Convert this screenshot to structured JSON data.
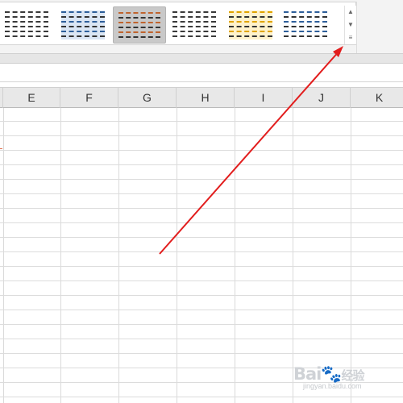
{
  "table_styles": {
    "styles": [
      {
        "name": "style-1",
        "line_color": "#3a3a3a",
        "band_color": "#ffffff"
      },
      {
        "name": "style-2",
        "line_color": "#2e5f9a",
        "band_color": "#dbe6f4"
      },
      {
        "name": "style-3",
        "line_color": "#c0632d",
        "band_color": "#c9c9c9",
        "selected": true
      },
      {
        "name": "style-4",
        "line_color": "#3a3a3a",
        "band_color": "#ffffff"
      },
      {
        "name": "style-5",
        "line_color": "#e0a400",
        "band_color": "#fff2cc"
      },
      {
        "name": "style-6",
        "line_color": "#2e5f9a",
        "band_color": "#ffffff"
      }
    ],
    "scroll_icons": [
      "scroll-up-icon",
      "scroll-down-icon",
      "more-styles-icon"
    ]
  },
  "columns": [
    "E",
    "F",
    "G",
    "H",
    "I",
    "J",
    "K"
  ],
  "annotation": {
    "arrow_color": "#e21d1d"
  },
  "watermark": {
    "brand": "Bai",
    "paw": "🐾",
    "suffix": "经验",
    "url": "jingyan.baidu.com"
  }
}
